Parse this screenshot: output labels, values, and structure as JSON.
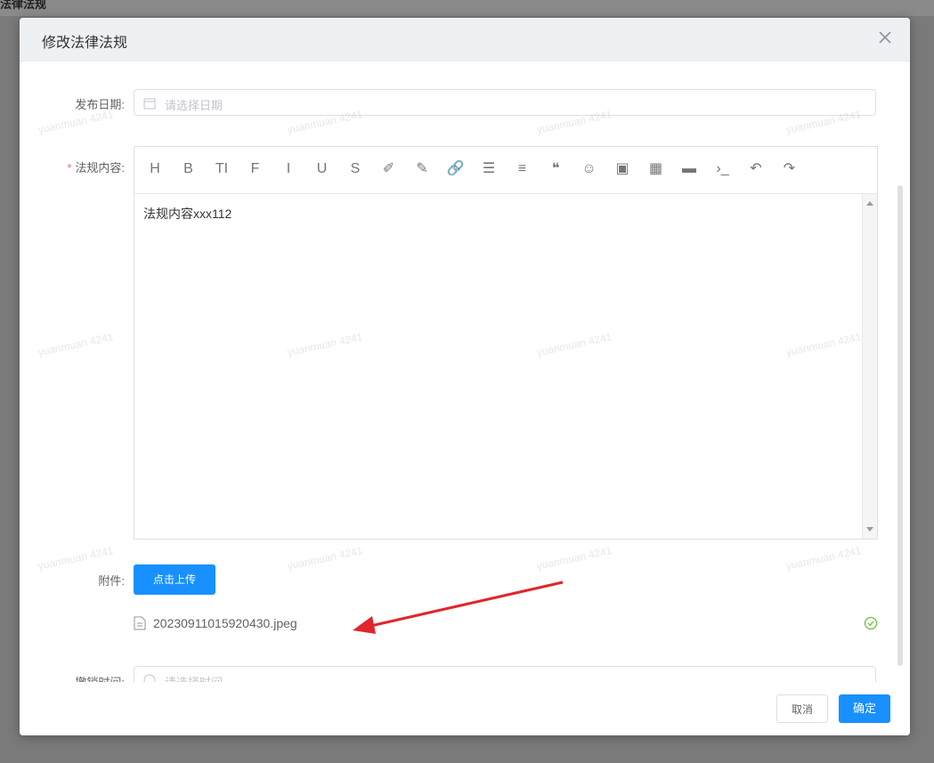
{
  "backdrop": {
    "title_fragment": "法律法规"
  },
  "dialog": {
    "title": "修改法律法规",
    "close_icon": "close-icon"
  },
  "form": {
    "publish_date": {
      "label": "发布日期:",
      "placeholder": "请选择日期"
    },
    "content": {
      "label": "法规内容:",
      "required_mark": "*",
      "value": "法规内容xxx112",
      "toolbar": [
        {
          "name": "heading",
          "glyph": "H"
        },
        {
          "name": "bold",
          "glyph": "B"
        },
        {
          "name": "font-size",
          "glyph": "TI"
        },
        {
          "name": "strikethrough-alt",
          "glyph": "F"
        },
        {
          "name": "italic",
          "glyph": "I"
        },
        {
          "name": "underline",
          "glyph": "U"
        },
        {
          "name": "strikethrough",
          "glyph": "S"
        },
        {
          "name": "highlight",
          "glyph": "✐"
        },
        {
          "name": "font-color",
          "glyph": "✎"
        },
        {
          "name": "link",
          "glyph": "🔗"
        },
        {
          "name": "unordered-list",
          "glyph": "☰"
        },
        {
          "name": "align",
          "glyph": "≡"
        },
        {
          "name": "quote",
          "glyph": "❝"
        },
        {
          "name": "emoji",
          "glyph": "☺"
        },
        {
          "name": "image",
          "glyph": "▣"
        },
        {
          "name": "table",
          "glyph": "▦"
        },
        {
          "name": "video",
          "glyph": "▬"
        },
        {
          "name": "code",
          "glyph": "›_"
        },
        {
          "name": "undo",
          "glyph": "↶"
        },
        {
          "name": "redo",
          "glyph": "↷"
        }
      ]
    },
    "attachment": {
      "label": "附件:",
      "upload_button": "点击上传",
      "file_name": "20230911015920430.jpeg"
    },
    "partial_field": {
      "label": "撤销时间:",
      "placeholder": "请选择时间"
    }
  },
  "footer": {
    "cancel": "取消",
    "confirm": "确定"
  },
  "watermark_text": "yuanmuan 4241",
  "colors": {
    "primary": "#1890ff",
    "required": "#f56c6c",
    "success": "#67c23a",
    "arrow": "#e0252b"
  }
}
